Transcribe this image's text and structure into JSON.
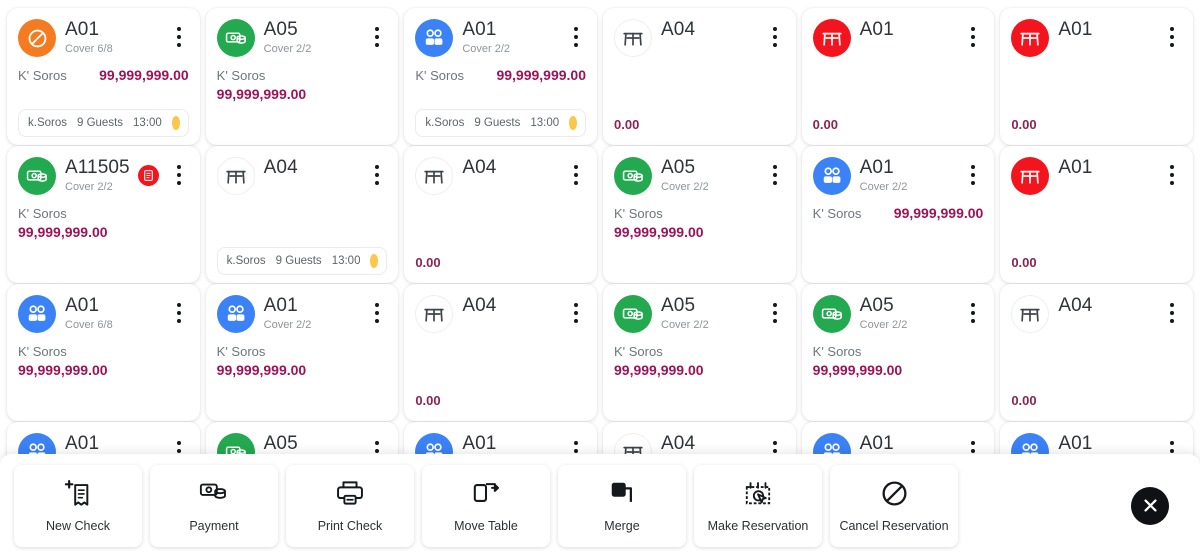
{
  "colors": {
    "orange": "#f47b20",
    "green": "#23a94f",
    "blue": "#3b82f6",
    "red": "#f4141e",
    "amount": "#9c1358",
    "dot_yellow": "#fac748",
    "card_bg": "#ffffff",
    "page_bg": "#ffffff"
  },
  "labels": {
    "amount_label": "K' Soros",
    "zero_amount": "0.00"
  },
  "cards": [
    {
      "id": "r1c1",
      "name": "A01",
      "cover": "Cover 6/8",
      "icon": "blocked-icon",
      "icon_color": "#f47b20",
      "amount_label": "K' Soros",
      "amount": "99,999,999.00",
      "amount_layout": "row",
      "reservation": {
        "name": "k.Soros",
        "guests": "9 Guests",
        "time": "13:00"
      },
      "badge": null
    },
    {
      "id": "r1c2",
      "name": "A05",
      "cover": "Cover 2/2",
      "icon": "money-icon",
      "icon_color": "#23a94f",
      "amount_label": "K' Soros",
      "amount": "99,999,999.00",
      "amount_layout": "col",
      "reservation": null,
      "badge": null
    },
    {
      "id": "r1c3",
      "name": "A01",
      "cover": "Cover 2/2",
      "icon": "guests-icon",
      "icon_color": "#3b82f6",
      "amount_label": "K' Soros",
      "amount": "99,999,999.00",
      "amount_layout": "row",
      "reservation": {
        "name": "k.Soros",
        "guests": "9 Guests",
        "time": "13:00"
      },
      "badge": null
    },
    {
      "id": "r1c4",
      "name": "A04",
      "cover": "",
      "icon": "table-icon",
      "icon_color": "plain",
      "amount_label": "",
      "amount": "0.00",
      "amount_layout": "zero",
      "reservation": null,
      "badge": null
    },
    {
      "id": "r1c5",
      "name": "A01",
      "cover": "",
      "icon": "table-filled-icon",
      "icon_color": "#f4141e",
      "amount_label": "",
      "amount": "0.00",
      "amount_layout": "zero",
      "reservation": null,
      "badge": null
    },
    {
      "id": "r1c6",
      "name": "A01",
      "cover": "",
      "icon": "table-filled-icon",
      "icon_color": "#f4141e",
      "amount_label": "",
      "amount": "0.00",
      "amount_layout": "zero",
      "reservation": null,
      "badge": null
    },
    {
      "id": "r2c1",
      "name": "A11505",
      "cover": "Cover 2/2",
      "icon": "money-icon",
      "icon_color": "#23a94f",
      "amount_label": "K' Soros",
      "amount": "99,999,999.00",
      "amount_layout": "col",
      "reservation": null,
      "badge": "print-alert-icon"
    },
    {
      "id": "r2c2",
      "name": "A04",
      "cover": "",
      "icon": "table-icon",
      "icon_color": "plain",
      "amount_label": "",
      "amount": "",
      "amount_layout": "none",
      "reservation": {
        "name": "k.Soros",
        "guests": "9 Guests",
        "time": "13:00"
      },
      "badge": null
    },
    {
      "id": "r2c3",
      "name": "A04",
      "cover": "",
      "icon": "table-icon",
      "icon_color": "plain",
      "amount_label": "",
      "amount": "0.00",
      "amount_layout": "zero",
      "reservation": null,
      "badge": null
    },
    {
      "id": "r2c4",
      "name": "A05",
      "cover": "Cover 2/2",
      "icon": "money-icon",
      "icon_color": "#23a94f",
      "amount_label": "K' Soros",
      "amount": "99,999,999.00",
      "amount_layout": "col",
      "reservation": null,
      "badge": null
    },
    {
      "id": "r2c5",
      "name": "A01",
      "cover": "Cover 2/2",
      "icon": "guests-icon",
      "icon_color": "#3b82f6",
      "amount_label": "K' Soros",
      "amount": "99,999,999.00",
      "amount_layout": "row",
      "reservation": null,
      "badge": null
    },
    {
      "id": "r2c6",
      "name": "A01",
      "cover": "",
      "icon": "table-filled-icon",
      "icon_color": "#f4141e",
      "amount_label": "",
      "amount": "0.00",
      "amount_layout": "zero",
      "reservation": null,
      "badge": null
    },
    {
      "id": "r3c1",
      "name": "A01",
      "cover": "Cover 6/8",
      "icon": "guests-icon",
      "icon_color": "#3b82f6",
      "amount_label": "K' Soros",
      "amount": "99,999,999.00",
      "amount_layout": "col",
      "reservation": null,
      "badge": null
    },
    {
      "id": "r3c2",
      "name": "A01",
      "cover": "Cover 2/2",
      "icon": "guests-icon",
      "icon_color": "#3b82f6",
      "amount_label": "K' Soros",
      "amount": "99,999,999.00",
      "amount_layout": "col",
      "reservation": null,
      "badge": null
    },
    {
      "id": "r3c3",
      "name": "A04",
      "cover": "",
      "icon": "table-icon",
      "icon_color": "plain",
      "amount_label": "",
      "amount": "0.00",
      "amount_layout": "zero",
      "reservation": null,
      "badge": null
    },
    {
      "id": "r3c4",
      "name": "A05",
      "cover": "Cover 2/2",
      "icon": "money-icon",
      "icon_color": "#23a94f",
      "amount_label": "K' Soros",
      "amount": "99,999,999.00",
      "amount_layout": "col",
      "reservation": null,
      "badge": null
    },
    {
      "id": "r3c5",
      "name": "A05",
      "cover": "Cover 2/2",
      "icon": "money-icon",
      "icon_color": "#23a94f",
      "amount_label": "K' Soros",
      "amount": "99,999,999.00",
      "amount_layout": "col",
      "reservation": null,
      "badge": null
    },
    {
      "id": "r3c6",
      "name": "A04",
      "cover": "",
      "icon": "table-icon",
      "icon_color": "plain",
      "amount_label": "",
      "amount": "0.00",
      "amount_layout": "zero",
      "reservation": null,
      "badge": null
    },
    {
      "id": "r4c1",
      "name": "A01",
      "cover": "",
      "icon": "guests-icon",
      "icon_color": "#3b82f6",
      "amount_label": "",
      "amount": "",
      "amount_layout": "none",
      "reservation": null,
      "badge": null
    },
    {
      "id": "r4c2",
      "name": "A05",
      "cover": "",
      "icon": "money-icon",
      "icon_color": "#23a94f",
      "amount_label": "",
      "amount": "",
      "amount_layout": "none",
      "reservation": null,
      "badge": null
    },
    {
      "id": "r4c3",
      "name": "A01",
      "cover": "",
      "icon": "guests-icon",
      "icon_color": "#3b82f6",
      "amount_label": "",
      "amount": "",
      "amount_layout": "none",
      "reservation": null,
      "badge": null
    },
    {
      "id": "r4c4",
      "name": "A04",
      "cover": "",
      "icon": "table-icon",
      "icon_color": "plain",
      "amount_label": "",
      "amount": "",
      "amount_layout": "none",
      "reservation": null,
      "badge": null
    },
    {
      "id": "r4c5",
      "name": "A01",
      "cover": "",
      "icon": "guests-icon",
      "icon_color": "#3b82f6",
      "amount_label": "",
      "amount": "",
      "amount_layout": "none",
      "reservation": null,
      "badge": null
    },
    {
      "id": "r4c6",
      "name": "A01",
      "cover": "",
      "icon": "guests-icon",
      "icon_color": "#3b82f6",
      "amount_label": "",
      "amount": "",
      "amount_layout": "none",
      "reservation": null,
      "badge": null
    }
  ],
  "toolbar": {
    "actions": [
      {
        "key": "new-check",
        "label": "New Check",
        "icon": "new-receipt-icon"
      },
      {
        "key": "payment",
        "label": "Payment",
        "icon": "money-icon"
      },
      {
        "key": "print-check",
        "label": "Print Check",
        "icon": "printer-icon"
      },
      {
        "key": "move-table",
        "label": "Move Table",
        "icon": "move-arrow-icon"
      },
      {
        "key": "merge",
        "label": "Merge",
        "icon": "merge-squares-icon"
      },
      {
        "key": "make-reservation",
        "label": "Make Reservation",
        "icon": "calendar-cursor-icon"
      },
      {
        "key": "cancel-reservation",
        "label": "Cancel Reservation",
        "icon": "blocked-icon"
      }
    ],
    "close_label": "Close"
  }
}
